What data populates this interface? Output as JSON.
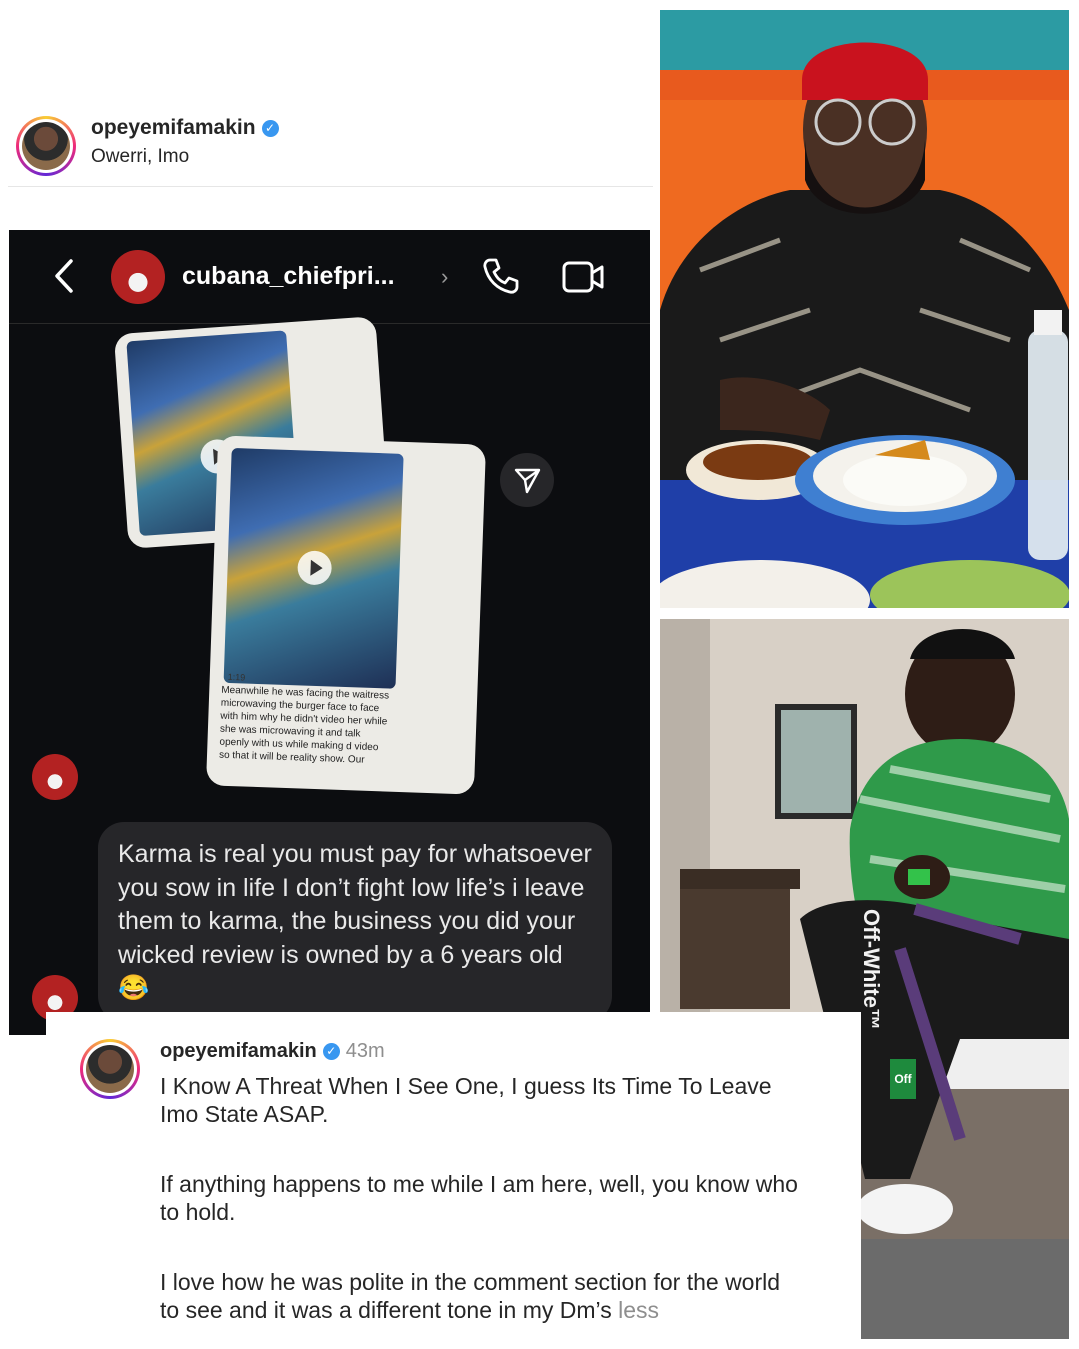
{
  "top_post": {
    "username": "opeyemifamakin",
    "location": "Owerri, Imo"
  },
  "dm": {
    "contact_name": "cubana_chiefpri...",
    "chevron": "›",
    "video_duration": "1:19",
    "video_caption": "Meanwhile he was facing the waitress microwaving the burger face to face with him why he didn't video her while she was microwaving it and talk openly with us while making d video so that it will be reality show. Our",
    "message": "Karma is real you must pay for whatsoever you sow in life I don’t fight low life’s i leave them to karma, the business you did your wicked review is owned by a 6 years old 😂"
  },
  "caption": {
    "username": "opeyemifamakin",
    "time": "43m",
    "paragraph1": "I Know A Threat When I See One, I guess Its Time To Leave Imo State ASAP.",
    "paragraph2": "If anything happens to me while I am here, well, you know who to hold.",
    "paragraph3": "I love how he was polite in the comment section for the world to see and it was a different tone in my Dm’s",
    "less": "less"
  },
  "photo2_text": {
    "pants_brand": "Off-White™",
    "tag": "Off"
  },
  "colors": {
    "dm_background": "#0c0d10",
    "bubble": "#262629",
    "verified": "#3897f0"
  }
}
